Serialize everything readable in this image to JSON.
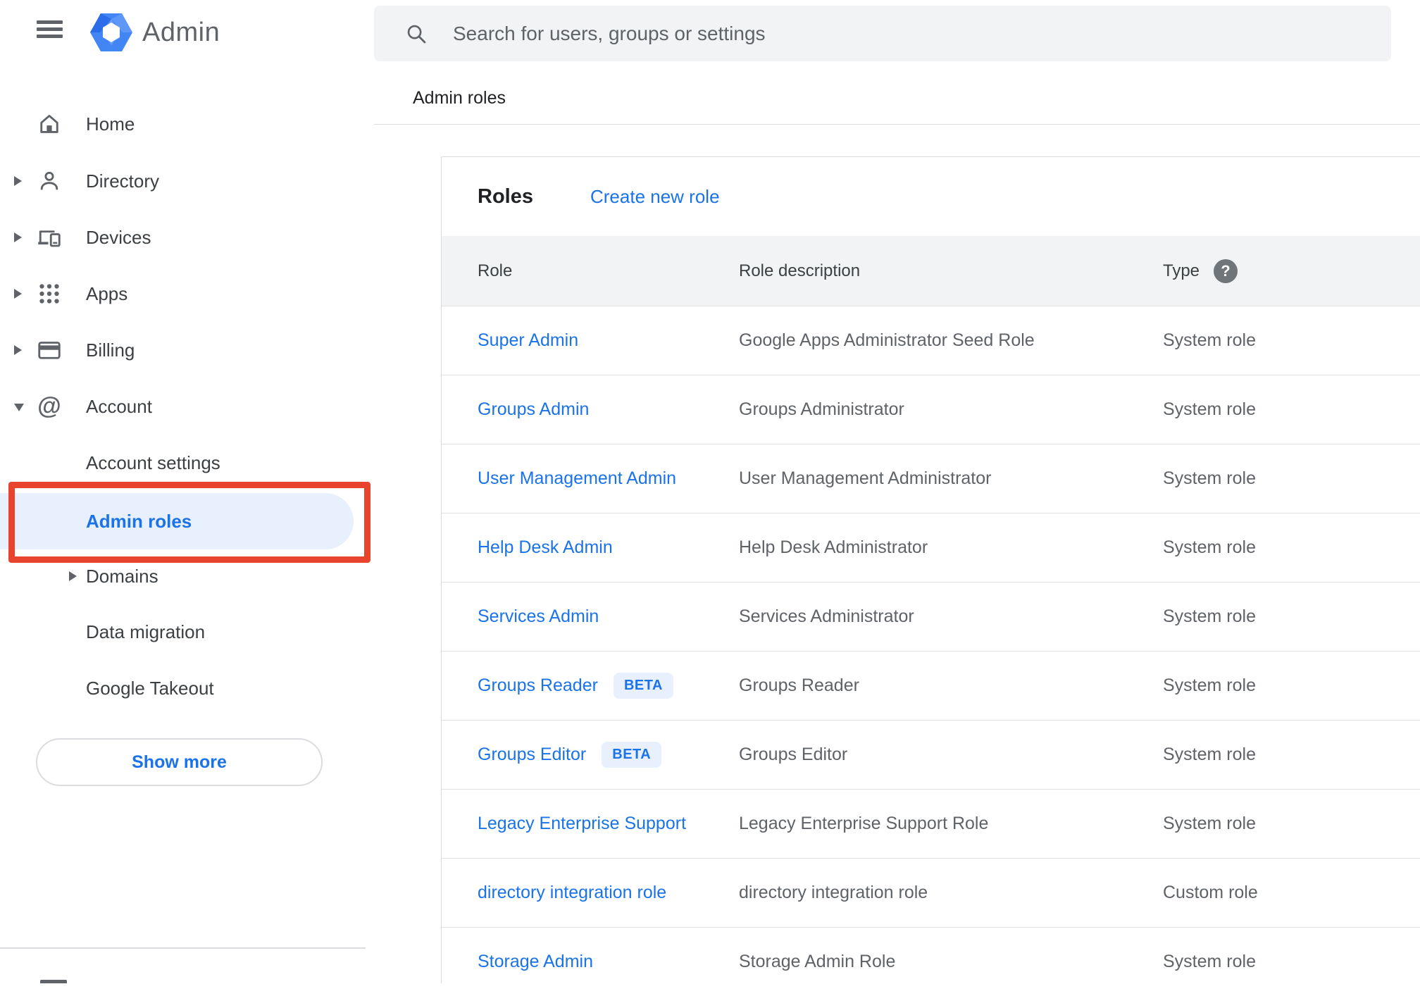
{
  "colors": {
    "accent_blue": "#1a73e8",
    "selected_item_bg": "#e8f0fe",
    "annotation_red": "#e8432d",
    "table_header_bg": "#f1f3f4",
    "beta_badge_bg": "#e8f0fe",
    "icon_gray": "#5f6368"
  },
  "app": {
    "product_name": "Admin"
  },
  "topbar": {
    "search_placeholder": "Search for users, groups or settings"
  },
  "breadcrumb": {
    "label": "Admin roles"
  },
  "sidebar": {
    "items": [
      {
        "label": "Home"
      },
      {
        "label": "Directory"
      },
      {
        "label": "Devices"
      },
      {
        "label": "Apps"
      },
      {
        "label": "Billing"
      },
      {
        "label": "Account"
      }
    ],
    "account_children": [
      {
        "label": "Account settings"
      },
      {
        "label": "Admin roles",
        "selected": true
      },
      {
        "label": "Domains"
      },
      {
        "label": "Data migration"
      },
      {
        "label": "Google Takeout"
      }
    ],
    "show_more": "Show more"
  },
  "icons": {
    "at_glyph": "@",
    "help_glyph": "?"
  },
  "main": {
    "section_title": "Roles",
    "create_link": "Create new role",
    "table": {
      "columns": {
        "role": "Role",
        "description": "Role description",
        "type": "Type"
      },
      "rows": [
        {
          "role": "Super Admin",
          "description": "Google Apps Administrator Seed Role",
          "type": "System role"
        },
        {
          "role": "Groups Admin",
          "description": "Groups Administrator",
          "type": "System role"
        },
        {
          "role": "User Management Admin",
          "description": "User Management Administrator",
          "type": "System role"
        },
        {
          "role": "Help Desk Admin",
          "description": "Help Desk Administrator",
          "type": "System role"
        },
        {
          "role": "Services Admin",
          "description": "Services Administrator",
          "type": "System role"
        },
        {
          "role": "Groups Reader",
          "badge": "BETA",
          "description": "Groups Reader",
          "type": "System role"
        },
        {
          "role": "Groups Editor",
          "badge": "BETA",
          "description": "Groups Editor",
          "type": "System role"
        },
        {
          "role": "Legacy Enterprise Support",
          "description": "Legacy Enterprise Support Role",
          "type": "System role"
        },
        {
          "role": "directory integration role",
          "description": "directory integration role",
          "type": "Custom role"
        },
        {
          "role": "Storage Admin",
          "description": "Storage Admin Role",
          "type": "System role"
        }
      ]
    }
  }
}
